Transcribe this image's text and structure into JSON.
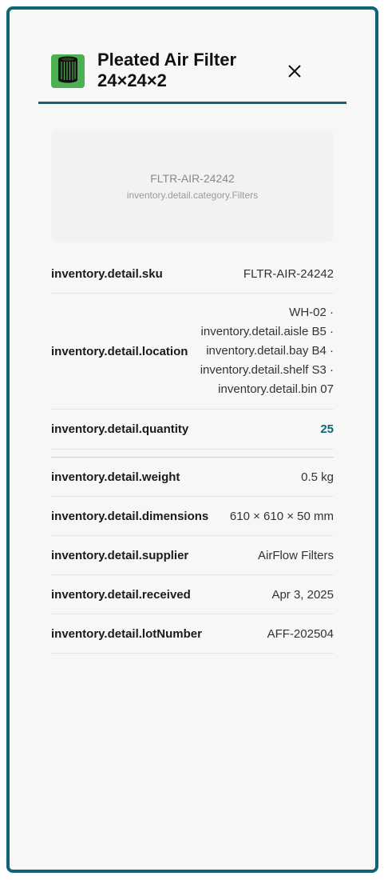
{
  "header": {
    "title_line1": "Pleated Air Filter",
    "title_line2": "24×24×2",
    "thumbnail_icon": "air-filter-icon",
    "close_icon": "close-icon"
  },
  "hero": {
    "sku": "FLTR-AIR-24242",
    "category": "inventory.detail.category.Filters"
  },
  "details": {
    "sku_label": "inventory.detail.sku",
    "sku_value": "FLTR-AIR-24242",
    "location_label": "inventory.detail.location",
    "location_lines": [
      "WH-02 ·",
      "inventory.detail.aisle B5 ·",
      "inventory.detail.bay B4 ·",
      "inventory.detail.shelf S3 ·",
      "inventory.detail.bin 07"
    ],
    "quantity_label": "inventory.detail.quantity",
    "quantity_value": "25",
    "weight_label": "inventory.detail.weight",
    "weight_value": "0.5 kg",
    "dimensions_label": "inventory.detail.dimensions",
    "dimensions_value": "610 × 610 × 50 mm",
    "supplier_label": "inventory.detail.supplier",
    "supplier_value": "AirFlow Filters",
    "received_label": "inventory.detail.received",
    "received_value": "Apr 3, 2025",
    "lot_label": "inventory.detail.lotNumber",
    "lot_value": "AFF-202504"
  },
  "colors": {
    "accent": "#0f6577",
    "thumbnail_bg": "#4caf50"
  }
}
